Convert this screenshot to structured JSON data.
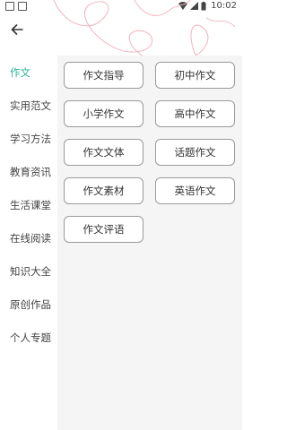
{
  "status_bar": {
    "time": "10:02"
  },
  "sidebar": {
    "items": [
      {
        "label": "作文",
        "active": true
      },
      {
        "label": "实用范文"
      },
      {
        "label": "学习方法"
      },
      {
        "label": "教育资讯"
      },
      {
        "label": "生活课堂"
      },
      {
        "label": "在线阅读"
      },
      {
        "label": "知识大全"
      },
      {
        "label": "原创作品"
      },
      {
        "label": "个人专题"
      }
    ]
  },
  "content": {
    "chips": [
      {
        "label": "作文指导"
      },
      {
        "label": "初中作文"
      },
      {
        "label": "小学作文"
      },
      {
        "label": "高中作文"
      },
      {
        "label": "作文文体"
      },
      {
        "label": "话题作文"
      },
      {
        "label": "作文素材"
      },
      {
        "label": "英语作文"
      },
      {
        "label": "作文评语"
      }
    ]
  },
  "colors": {
    "accent": "#2bb59a",
    "decoration": "#f3b9c4"
  }
}
